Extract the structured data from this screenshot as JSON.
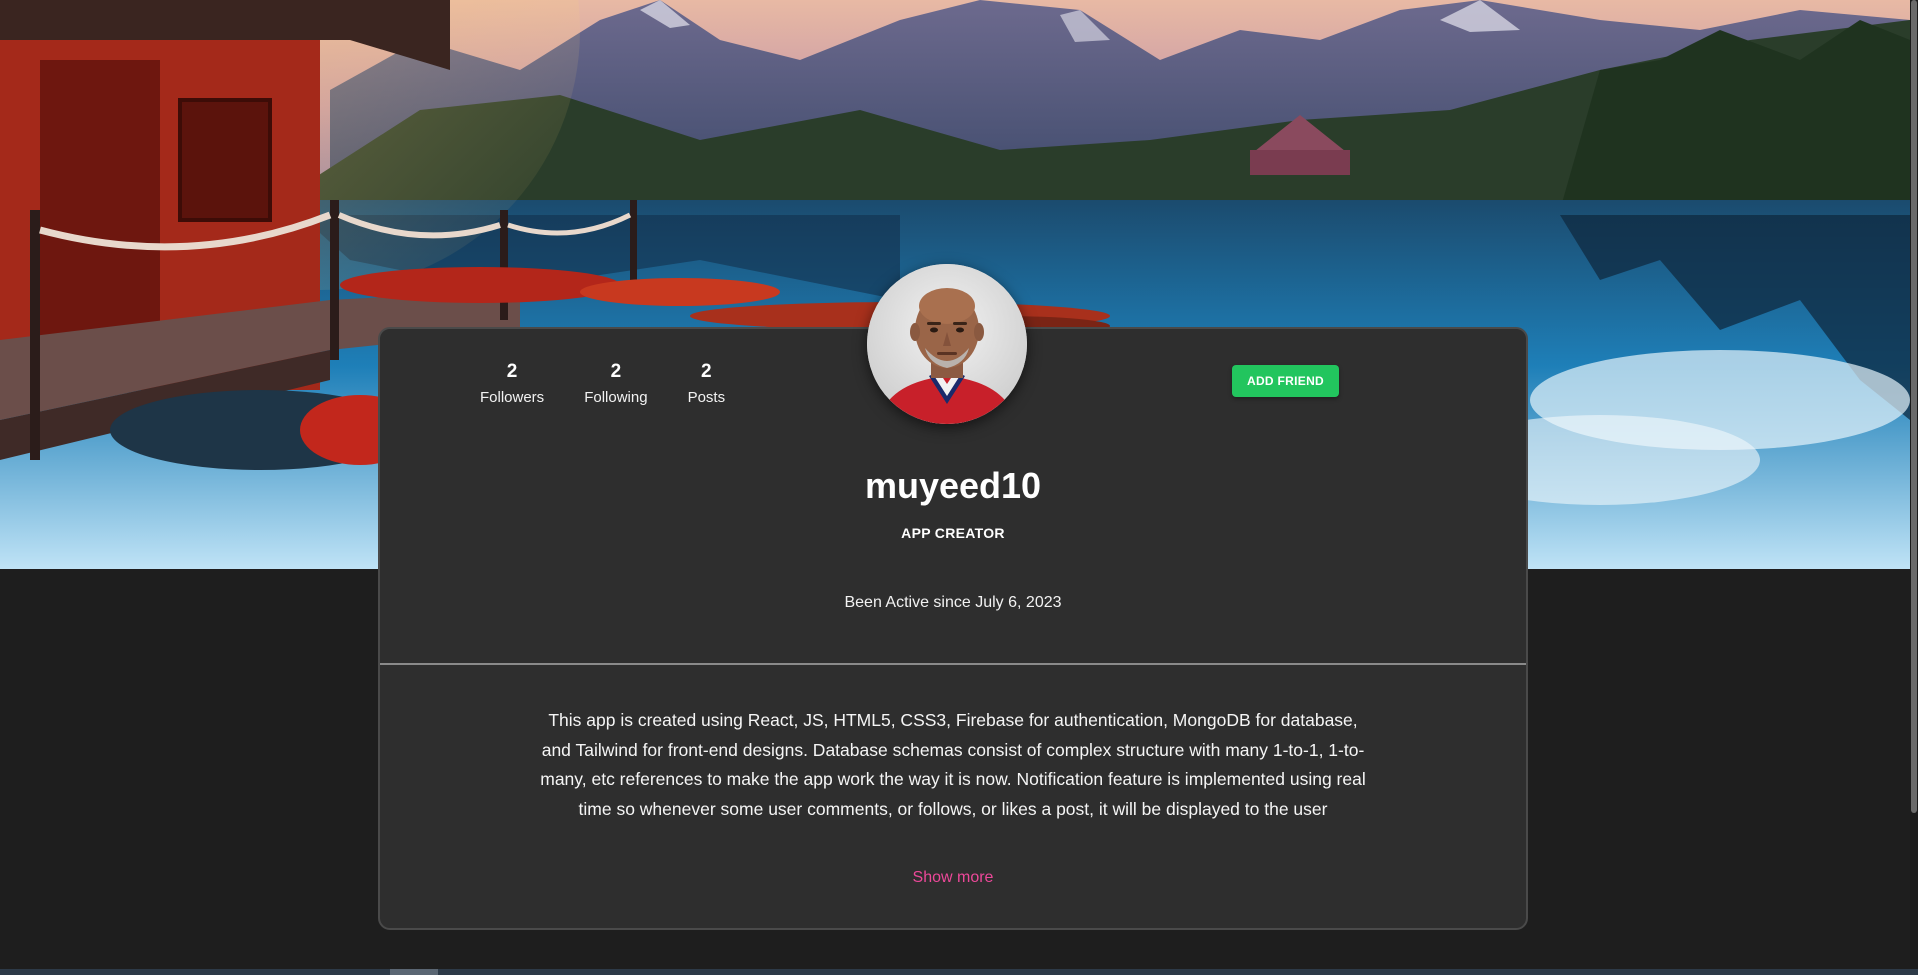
{
  "profile": {
    "username": "muyeed10",
    "role": "APP CREATOR",
    "active_since": "Been Active since July 6, 2023",
    "add_friend_label": "ADD FRIEND",
    "stats": [
      {
        "value": "2",
        "label": "Followers"
      },
      {
        "value": "2",
        "label": "Following"
      },
      {
        "value": "2",
        "label": "Posts"
      }
    ],
    "bio": "This app is created using React, JS, HTML5, CSS3, Firebase for authentication, MongoDB for database, and Tailwind for front-end designs. Database schemas consist of complex structure with many 1-to-1, 1-to-many, etc references to make the app work the way it is now. Notification feature is implemented using real time so whenever some user comments, or follows, or likes a post, it will be displayed to the user",
    "show_more_label": "Show more"
  },
  "colors": {
    "page_background": "#1e1e1e",
    "card_background": "#2e2e2e",
    "add_friend_button": "#22c55e",
    "show_more_link": "#ec4899"
  },
  "icons": {
    "cover": "lake-mountain-cover-image",
    "avatar": "user-avatar-photo"
  }
}
